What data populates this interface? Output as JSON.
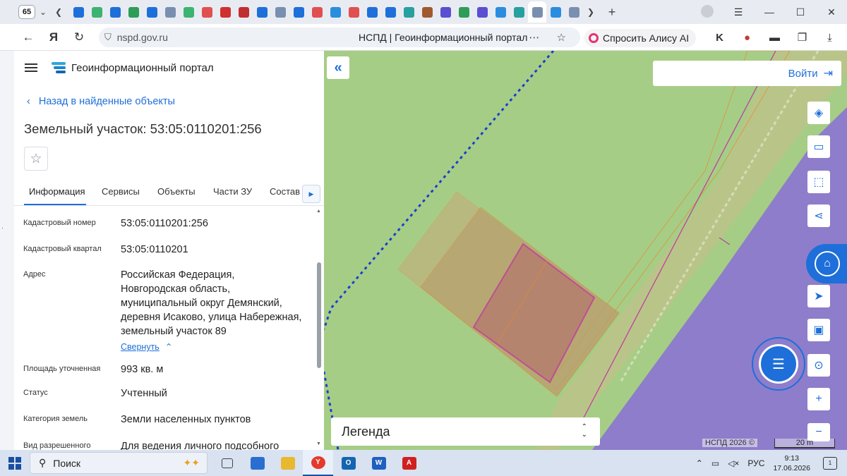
{
  "browser": {
    "tab_count": "65",
    "tab_icon_colors": [
      "#1e6fd9",
      "#3cb371",
      "#1e6fd9",
      "#2e9d5a",
      "#1e6fd9",
      "#7a8fb0",
      "#3cb371",
      "#e05050",
      "#d03030",
      "#c03030",
      "#1e6fd9",
      "#7a8fb0",
      "#1e6fd9",
      "#e05050",
      "#2a8de0",
      "#e05050",
      "#1e6fd9",
      "#1e6fd9",
      "#27a0a0",
      "#a05a30",
      "#5a4fd0",
      "#2e9d5a",
      "#5a4fd0",
      "#2a8de0",
      "#27a0a0",
      "#7a8fb0",
      "#2a8de0",
      "#7a8fb0"
    ],
    "url": "nspd.gov.ru",
    "page_title": "НСПД | Геоинформационный портал",
    "alice_label": "Спросить Алису AI"
  },
  "panel": {
    "portal_title": "Геоинформационный портал",
    "back_label": "Назад в найденные объекты",
    "title": "Земельный участок: 53:05:0110201:256",
    "tabs": [
      "Информация",
      "Сервисы",
      "Объекты",
      "Части ЗУ",
      "Состав"
    ],
    "fields": [
      {
        "label": "Кадастровый номер",
        "value": "53:05:0110201:256"
      },
      {
        "label": "Кадастровый квартал",
        "value": "53:05:0110201"
      },
      {
        "label": "Адрес",
        "value": "Российская Федерация, Новгородская область, муниципальный округ Демянский, деревня Исаково, улица Набережная, земельный участок 89"
      },
      {
        "label": "Площадь уточненная",
        "value": "993 кв. м"
      },
      {
        "label": "Статус",
        "value": "Учтенный"
      },
      {
        "label": "Категория земель",
        "value": "Земли населенных пунктов"
      },
      {
        "label": "Вид разрешенного",
        "value": "Для ведения личного подсобного"
      }
    ],
    "collapse_label": "Свернуть"
  },
  "map": {
    "login_label": "Войти",
    "legend_label": "Легенда",
    "copyright": "НСПД 2026 ©",
    "scale_label": "20 m",
    "tools": [
      "layers-icon",
      "ruler-icon",
      "select-area-icon",
      "share-icon",
      "parcel-search-icon",
      "locate-icon",
      "minimap-icon",
      "point-search-icon",
      "zoom-in-icon",
      "zoom-out-icon"
    ],
    "colors": {
      "background": "#a6cd86",
      "accent": "#1e6fd9",
      "water": "#8a6fd6"
    }
  },
  "taskbar": {
    "search_placeholder": "Поиск",
    "lang": "РУС",
    "time": "9:13",
    "date": "17.06.2026",
    "notifications": "1"
  }
}
